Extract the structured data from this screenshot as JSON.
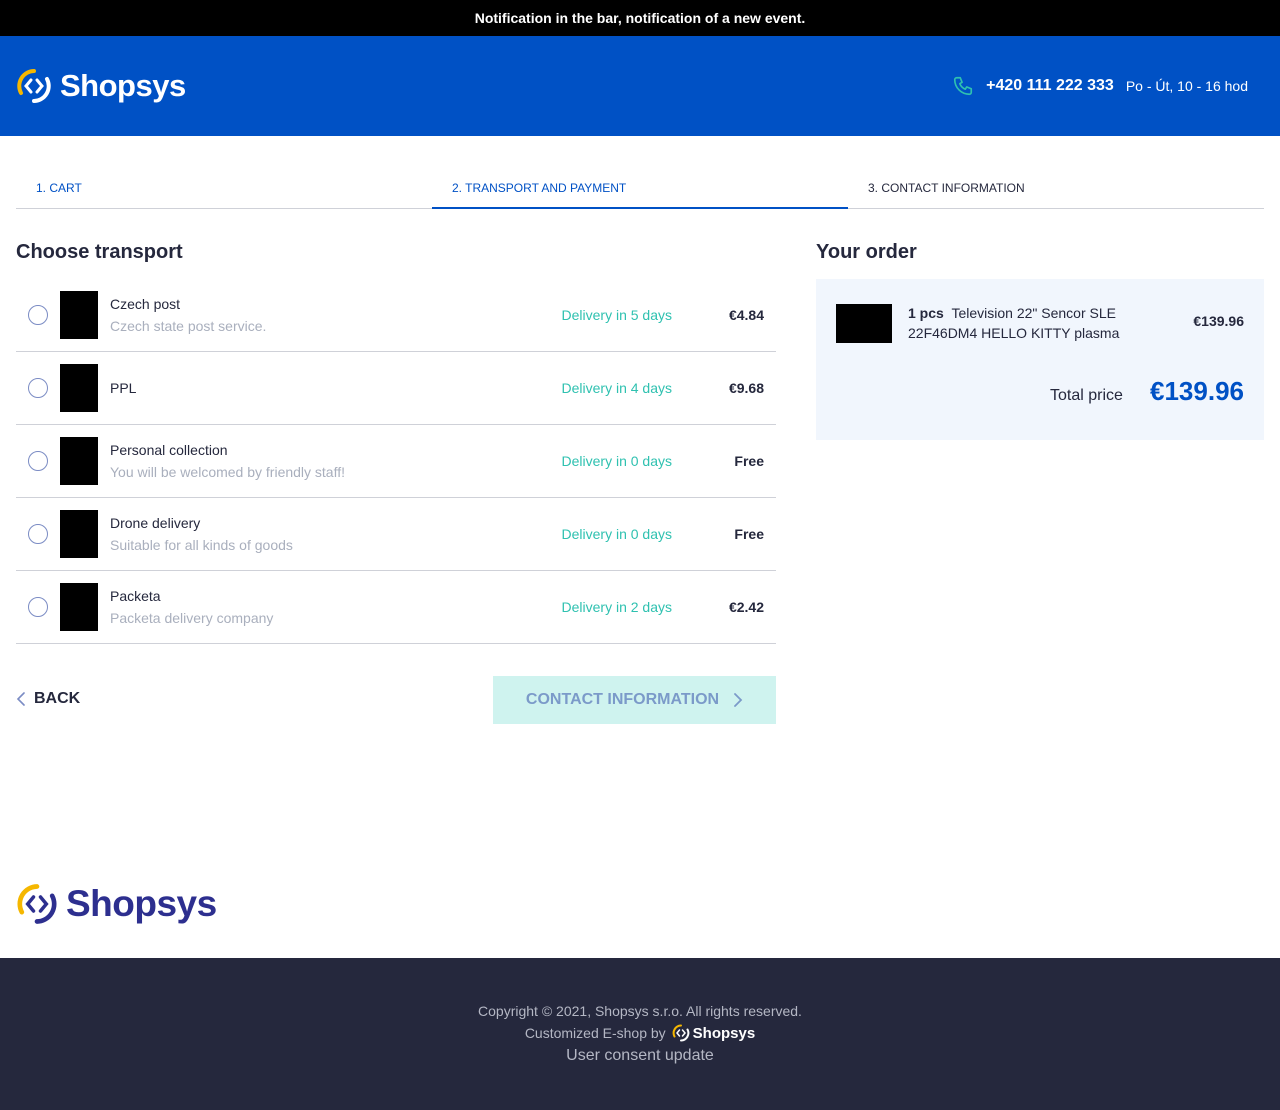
{
  "notification": "Notification in the bar, notification of a new event.",
  "header": {
    "logo": "Shopsys",
    "phone": "+420 111 222 333",
    "hours": "Po - Út, 10 - 16 hod"
  },
  "steps": [
    {
      "label": "1. Cart"
    },
    {
      "label": "2. Transport and payment"
    },
    {
      "label": "3. Contact information"
    }
  ],
  "transport": {
    "title": "Choose transport",
    "options": [
      {
        "name": "Czech post",
        "description": "Czech state post service.",
        "delivery": "Delivery in 5 days",
        "price": "€4.84"
      },
      {
        "name": "PPL",
        "description": "",
        "delivery": "Delivery in 4 days",
        "price": "€9.68"
      },
      {
        "name": "Personal collection",
        "description": "You will be welcomed by friendly staff!",
        "delivery": "Delivery in 0 days",
        "price": "Free"
      },
      {
        "name": "Drone delivery",
        "description": "Suitable for all kinds of goods",
        "delivery": "Delivery in 0 days",
        "price": "Free"
      },
      {
        "name": "Packeta",
        "description": "Packeta delivery company",
        "delivery": "Delivery in 2 days",
        "price": "€2.42"
      }
    ]
  },
  "navigation": {
    "back": "Back",
    "next": "Contact information"
  },
  "order": {
    "title": "Your order",
    "item": {
      "quantity": "1 pcs",
      "name": "Television 22\" Sencor SLE 22F46DM4 HELLO KITTY plasma",
      "price": "€139.96"
    },
    "total_label": "Total price",
    "total_value": "€139.96"
  },
  "footer": {
    "logo": "Shopsys",
    "copyright": "Copyright © 2021, Shopsys s.r.o. All rights reserved.",
    "customized": "Customized E-shop by",
    "customized_logo": "Shopsys",
    "consent": "User consent update"
  },
  "colors": {
    "brand_blue": "#0051c5",
    "accent_teal": "#2fc1b0",
    "logo_yellow": "#f5b700",
    "footer_bg": "#25283d"
  }
}
